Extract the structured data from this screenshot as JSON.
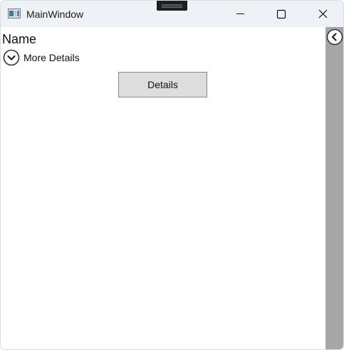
{
  "window": {
    "title": "MainWindow",
    "app_icon": "window-app-icon",
    "caption_buttons": {
      "minimize_icon": "minimize-icon",
      "maximize_icon": "maximize-icon",
      "close_icon": "close-icon"
    }
  },
  "main": {
    "name_label": "Name",
    "expander": {
      "header": "More Details",
      "icon": "chevron-down-icon",
      "expanded": false
    },
    "details_button": "Details"
  },
  "side_panel": {
    "toggle_icon": "chevron-left-icon",
    "background": "#a6a6a6"
  },
  "colors": {
    "titlebar": "#eef2f7",
    "button_background": "#dddddd",
    "button_border": "#8a8a8a"
  }
}
